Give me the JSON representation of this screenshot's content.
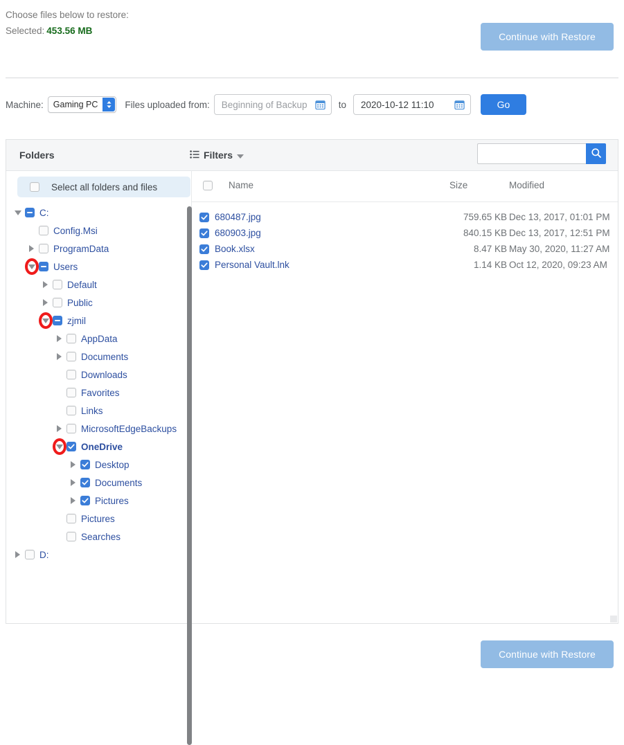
{
  "header": {
    "note": "Choose files below to restore:",
    "selected_label": "Selected:",
    "selected_size": "453.56 MB",
    "continue_label": "Continue with Restore"
  },
  "filters": {
    "machine_label": "Machine:",
    "machine_value": "Gaming PC",
    "uploaded_label": "Files uploaded from:",
    "from_placeholder": "Beginning of Backup",
    "to_label": "to",
    "to_value": "2020-10-12 11:10",
    "go_label": "Go"
  },
  "panel": {
    "folders_title": "Folders",
    "filters_title": "Filters",
    "search_value": "",
    "search_placeholder": "",
    "select_all_label": "Select all folders and files",
    "columns": {
      "name": "Name",
      "size": "Size",
      "modified": "Modified"
    }
  },
  "tree": [
    {
      "label": "C:",
      "depth": 0,
      "state": "indeterminate",
      "toggle": "open",
      "ring": false,
      "bold": false
    },
    {
      "label": "Config.Msi",
      "depth": 1,
      "state": "off",
      "toggle": "none",
      "ring": false,
      "bold": false
    },
    {
      "label": "ProgramData",
      "depth": 1,
      "state": "off",
      "toggle": "closed",
      "ring": false,
      "bold": false
    },
    {
      "label": "Users",
      "depth": 1,
      "state": "indeterminate",
      "toggle": "open",
      "ring": true,
      "bold": false
    },
    {
      "label": "Default",
      "depth": 2,
      "state": "off",
      "toggle": "closed",
      "ring": false,
      "bold": false
    },
    {
      "label": "Public",
      "depth": 2,
      "state": "off",
      "toggle": "closed",
      "ring": false,
      "bold": false
    },
    {
      "label": "zjmil",
      "depth": 2,
      "state": "indeterminate",
      "toggle": "open",
      "ring": true,
      "bold": false
    },
    {
      "label": "AppData",
      "depth": 3,
      "state": "off",
      "toggle": "closed",
      "ring": false,
      "bold": false
    },
    {
      "label": "Documents",
      "depth": 3,
      "state": "off",
      "toggle": "closed",
      "ring": false,
      "bold": false
    },
    {
      "label": "Downloads",
      "depth": 3,
      "state": "off",
      "toggle": "none",
      "ring": false,
      "bold": false
    },
    {
      "label": "Favorites",
      "depth": 3,
      "state": "off",
      "toggle": "none",
      "ring": false,
      "bold": false
    },
    {
      "label": "Links",
      "depth": 3,
      "state": "off",
      "toggle": "none",
      "ring": false,
      "bold": false
    },
    {
      "label": "MicrosoftEdgeBackups",
      "depth": 3,
      "state": "off",
      "toggle": "closed",
      "ring": false,
      "bold": false
    },
    {
      "label": "OneDrive",
      "depth": 3,
      "state": "on",
      "toggle": "open",
      "ring": true,
      "bold": true
    },
    {
      "label": "Desktop",
      "depth": 4,
      "state": "on",
      "toggle": "closed",
      "ring": false,
      "bold": false
    },
    {
      "label": "Documents",
      "depth": 4,
      "state": "on",
      "toggle": "closed",
      "ring": false,
      "bold": false
    },
    {
      "label": "Pictures",
      "depth": 4,
      "state": "on",
      "toggle": "closed",
      "ring": false,
      "bold": false
    },
    {
      "label": "Pictures",
      "depth": 3,
      "state": "off",
      "toggle": "none",
      "ring": false,
      "bold": false
    },
    {
      "label": "Searches",
      "depth": 3,
      "state": "off",
      "toggle": "none",
      "ring": false,
      "bold": false
    },
    {
      "label": "D:",
      "depth": 0,
      "state": "off",
      "toggle": "closed",
      "ring": false,
      "bold": false
    }
  ],
  "files": [
    {
      "name": "680487.jpg",
      "size": "759.65 KB",
      "modified": "Dec 13, 2017, 01:01 PM",
      "checked": true
    },
    {
      "name": "680903.jpg",
      "size": "840.15 KB",
      "modified": "Dec 13, 2017, 12:51 PM",
      "checked": true
    },
    {
      "name": "Book.xlsx",
      "size": "8.47 KB",
      "modified": "May 30, 2020, 11:27 AM",
      "checked": true
    },
    {
      "name": "Personal Vault.lnk",
      "size": "1.14 KB",
      "modified": "Oct 12, 2020, 09:23 AM",
      "checked": true
    }
  ],
  "footer": {
    "continue_label": "Continue with Restore"
  },
  "colors": {
    "accent_blue": "#2f7de1",
    "muted_blue": "#92bbe4",
    "link_blue": "#2d4fa0",
    "selected_green": "#176b1c",
    "annotation_red": "#ef1b1b"
  }
}
